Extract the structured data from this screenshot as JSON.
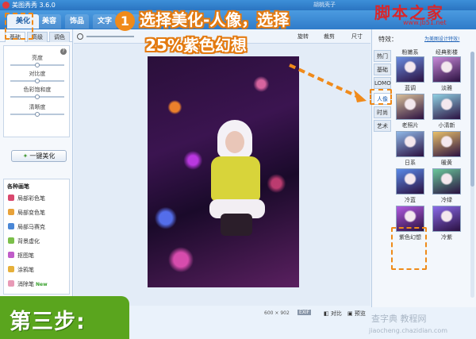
{
  "window": {
    "title": "美图秀秀 3.6.0",
    "user": "胡桃壳子"
  },
  "menu": {
    "tabs": [
      {
        "label": "美化"
      },
      {
        "label": "美容"
      },
      {
        "label": "饰品"
      },
      {
        "label": "文字"
      },
      {
        "label": "边"
      }
    ]
  },
  "toolbar": {
    "rotate_label": "旋转",
    "crop_label": "裁剪",
    "resize_label": "尺寸"
  },
  "left": {
    "subtabs": [
      "基础",
      "高级",
      "调色"
    ],
    "info_icon": "?",
    "sliders": [
      {
        "label": "亮度",
        "value": 0.5
      },
      {
        "label": "对比度",
        "value": 0.5
      },
      {
        "label": "色彩饱和度",
        "value": 0.5
      },
      {
        "label": "清晰度",
        "value": 0.5
      }
    ],
    "onekey_label": "一键美化",
    "brush_title": "各种画笔",
    "brushes": [
      {
        "label": "局部彩色笔",
        "color": "#d9486e"
      },
      {
        "label": "局部变色笔",
        "color": "#e8a23a"
      },
      {
        "label": "局部马赛克",
        "color": "#4a87d6"
      },
      {
        "label": "背景虚化",
        "color": "#7bbf4a"
      },
      {
        "label": "抠图笔",
        "color": "#c05cc9"
      },
      {
        "label": "涂鸦笔",
        "color": "#e6b03a"
      },
      {
        "label": "消除笔",
        "color": "#e89ab6",
        "badge": "New"
      }
    ]
  },
  "canvas": {
    "image_width": "600",
    "times": "×",
    "image_height": "902",
    "exif": "EXIF",
    "compare": "对比",
    "preview": "预览"
  },
  "right": {
    "title": "特效：",
    "link": "为美图设计特效!",
    "side_tabs": [
      {
        "label": "热门",
        "active": false
      },
      {
        "label": "基础",
        "active": false
      },
      {
        "label": "LOMO",
        "active": false
      },
      {
        "label": "人像",
        "active": true
      },
      {
        "label": "时尚",
        "active": false
      },
      {
        "label": "艺术",
        "active": false
      }
    ],
    "top_labels": [
      "粉嫩系",
      "经典影楼"
    ],
    "effects": [
      {
        "label": "蓝调",
        "tint": "#6a8ce0"
      },
      {
        "label": "淡雅",
        "tint": "#c88ad8"
      },
      {
        "label": "老照片",
        "tint": "#d9c09a"
      },
      {
        "label": "小清新",
        "tint": "#8fd0e2"
      },
      {
        "label": "日系",
        "tint": "#8fb8e8"
      },
      {
        "label": "暖黄",
        "tint": "#e8c06a"
      },
      {
        "label": "冷蓝",
        "tint": "#5a8ae8"
      },
      {
        "label": "冷绿",
        "tint": "#6ac89a"
      },
      {
        "label": "紫色幻想",
        "tint": "#b05ae0"
      },
      {
        "label": "冷紫",
        "tint": "#8a6ae8"
      }
    ]
  },
  "annotation": {
    "step_number": "1",
    "line1": "选择美化-人像，选择",
    "line2": "25%紫色幻想",
    "step_banner": "第三步:",
    "accent_color": "#f08a1a"
  },
  "watermark": {
    "logo": "脚本之家",
    "url": "www.jb51.net",
    "bottom1": "查字典 教程网",
    "bottom2": "jiaocheng.chazidian.com"
  }
}
